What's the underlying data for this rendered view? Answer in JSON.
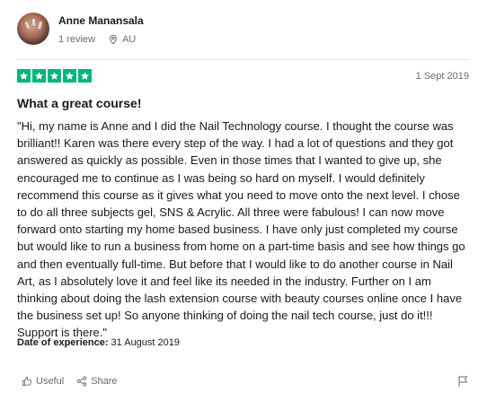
{
  "reviewer": {
    "name": "Anne Manansala",
    "reviews": "1 review",
    "location": "AU"
  },
  "review": {
    "rating": 5,
    "rating_max": 5,
    "star_color": "#00b67a",
    "date": "1 Sept 2019",
    "title": "What a great course!",
    "body": "\"Hi, my name is Anne and I did the Nail Technology course. I thought the course was brilliant!! Karen was there every step of the way. I had a lot of questions and they got answered as quickly as possible. Even in those times that I wanted to give up, she encouraged me to continue as I was being so hard on myself. I would definitely recommend this course as it gives what you need to move onto the next level. I chose to do all three subjects gel, SNS & Acrylic. All three were fabulous! I can now move forward onto starting my home based business. I have only just completed my course but would like to run a business from home on a part-time basis and see how things go and then eventually full-time. But before that I would like to do another course in Nail Art, as I absolutely love it and feel like its needed in the industry. Further on I am thinking about doing the lash extension course with beauty courses online once I have the business set up! So anyone thinking of doing the nail tech course, just do it!!! Support is there.\"",
    "experience_label": "Date of experience:",
    "experience_date": "31 August 2019"
  },
  "actions": {
    "useful_label": "Useful",
    "share_label": "Share"
  },
  "icons": {
    "location": "map-pin-icon",
    "star": "star-icon",
    "useful": "thumbs-up-icon",
    "share": "share-icon",
    "report": "flag-icon"
  }
}
